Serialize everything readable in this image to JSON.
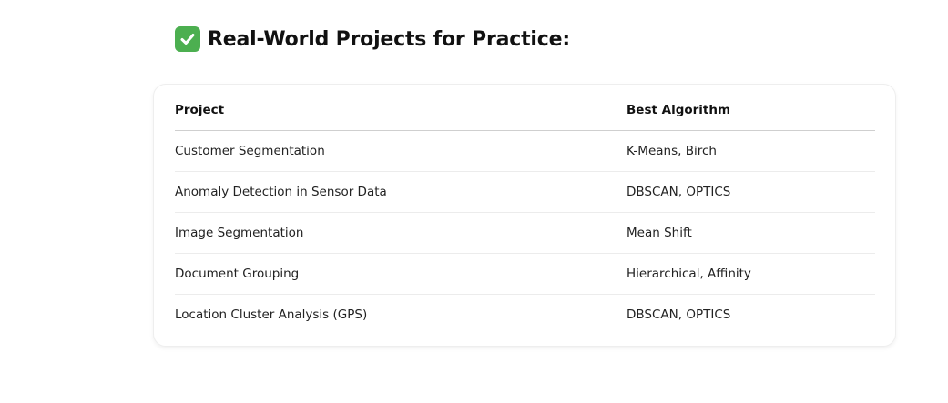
{
  "heading": {
    "icon": "white-check-mark-icon",
    "text": "Real-World Projects for Practice:"
  },
  "table": {
    "columns": [
      "Project",
      "Best Algorithm"
    ],
    "rows": [
      [
        "Customer Segmentation",
        "K-Means, Birch"
      ],
      [
        "Anomaly Detection in Sensor Data",
        "DBSCAN, OPTICS"
      ],
      [
        "Image Segmentation",
        "Mean Shift"
      ],
      [
        "Document Grouping",
        "Hierarchical, Affinity"
      ],
      [
        "Location Cluster Analysis (GPS)",
        "DBSCAN, OPTICS"
      ]
    ]
  },
  "colors": {
    "check_icon_bg": "#4caf50",
    "text": "#111111",
    "header_rule": "#cfcfcf",
    "row_rule": "#ececec"
  }
}
